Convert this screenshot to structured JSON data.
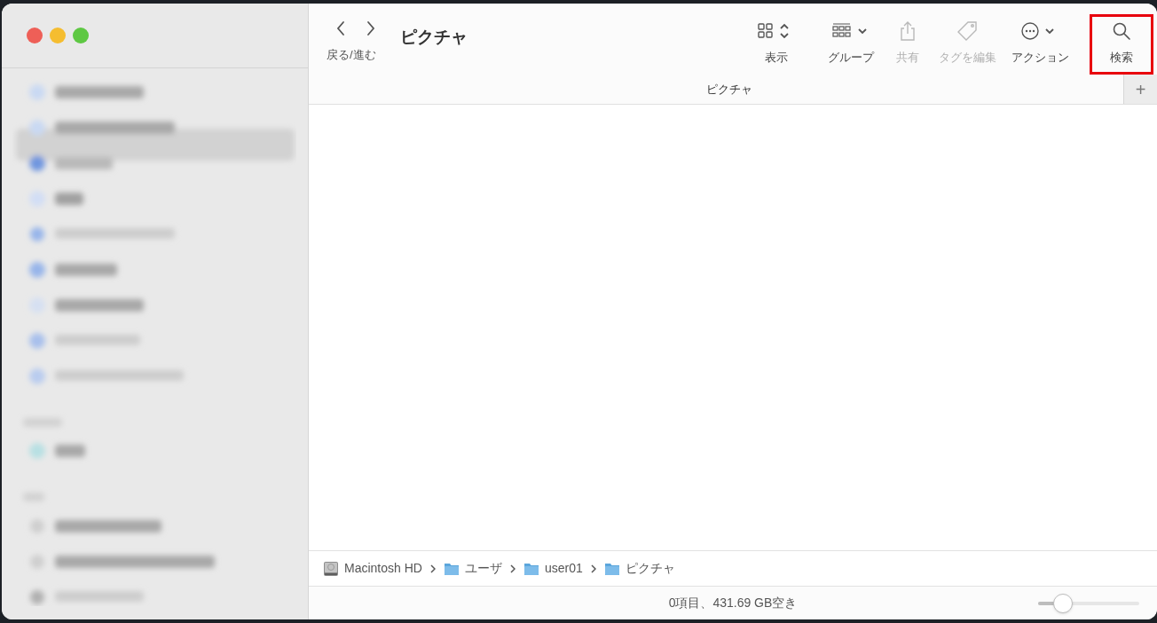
{
  "window": {
    "traffic_lights": [
      {
        "color": "#ee5f57"
      },
      {
        "color": "#f5bd30"
      },
      {
        "color": "#5ec843"
      }
    ]
  },
  "toolbar": {
    "nav_label": "戻る/進む",
    "title": "ピクチャ",
    "items": [
      {
        "kind": "view",
        "label": "表示",
        "disabled": false,
        "highlighted": false
      },
      {
        "kind": "group",
        "label": "グループ",
        "disabled": false,
        "highlighted": false
      },
      {
        "kind": "share",
        "label": "共有",
        "disabled": true,
        "highlighted": false
      },
      {
        "kind": "tag",
        "label": "タグを編集",
        "disabled": true,
        "highlighted": false
      },
      {
        "kind": "action",
        "label": "アクション",
        "disabled": false,
        "highlighted": false
      },
      {
        "kind": "search",
        "label": "検索",
        "disabled": false,
        "highlighted": true
      }
    ]
  },
  "tab_bar": {
    "tabs": [
      {
        "label": "ピクチャ",
        "selected": true
      }
    ],
    "add_label": "+"
  },
  "path_bar": [
    {
      "kind": "disk",
      "label": "Macintosh HD"
    },
    {
      "kind": "folder",
      "label": "ユーザ"
    },
    {
      "kind": "folder",
      "label": "user01"
    },
    {
      "kind": "folder",
      "label": "ピクチャ"
    }
  ],
  "status_bar": {
    "text": "0項目、431.69 GB空き",
    "zoom_slider": {
      "level": 0.18
    }
  }
}
